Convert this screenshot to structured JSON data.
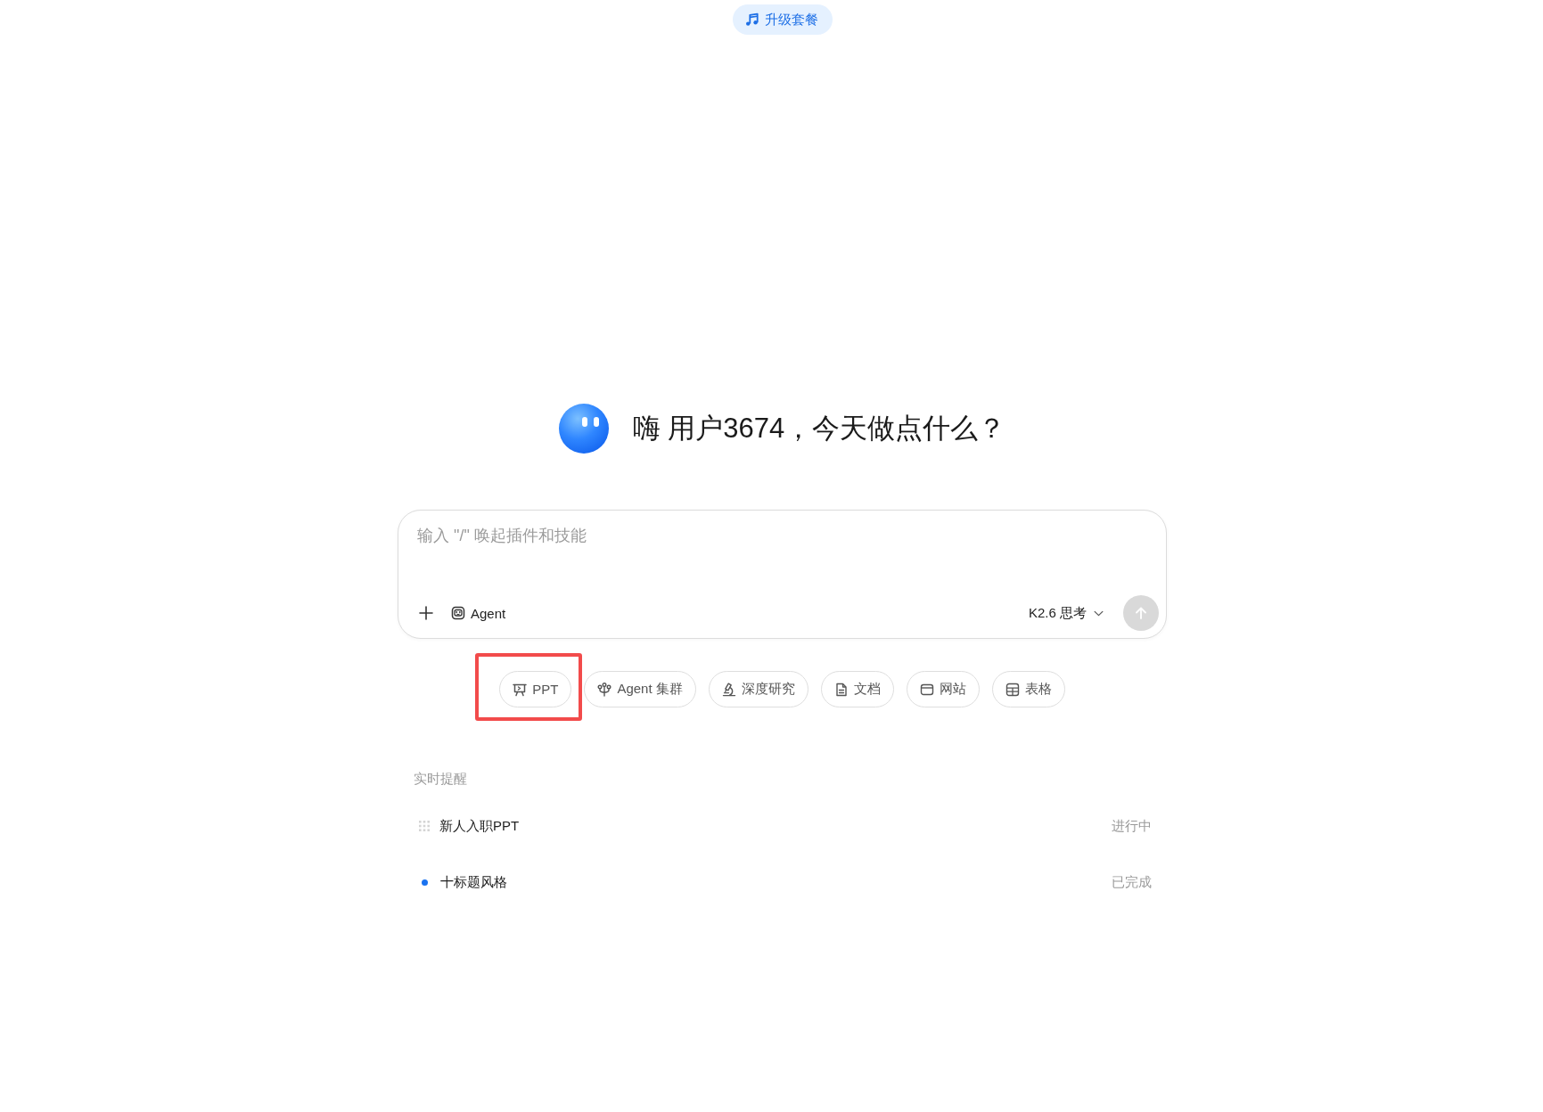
{
  "upgrade_badge": {
    "label": "升级套餐"
  },
  "greeting": {
    "text": "嗨 用户3674，今天做点什么？"
  },
  "composer": {
    "placeholder": "输入 \"/\" 唤起插件和技能",
    "agent_button": {
      "label": "Agent"
    },
    "model_selector": {
      "label": "K2.6 思考"
    },
    "send_button": {
      "disabled": true
    }
  },
  "quick_actions": [
    {
      "kind": "ppt",
      "label": "PPT",
      "highlighted": true
    },
    {
      "kind": "cluster",
      "label": "Agent 集群",
      "highlighted": false
    },
    {
      "kind": "research",
      "label": "深度研究",
      "highlighted": false
    },
    {
      "kind": "doc",
      "label": "文档",
      "highlighted": false
    },
    {
      "kind": "website",
      "label": "网站",
      "highlighted": false
    },
    {
      "kind": "sheet",
      "label": "表格",
      "highlighted": false
    }
  ],
  "reminders": {
    "title": "实时提醒",
    "items": [
      {
        "kind": "in_progress",
        "title": "新人入职PPT",
        "status": "进行中"
      },
      {
        "kind": "done",
        "title": "十标题风格",
        "status": "已完成"
      }
    ]
  }
}
